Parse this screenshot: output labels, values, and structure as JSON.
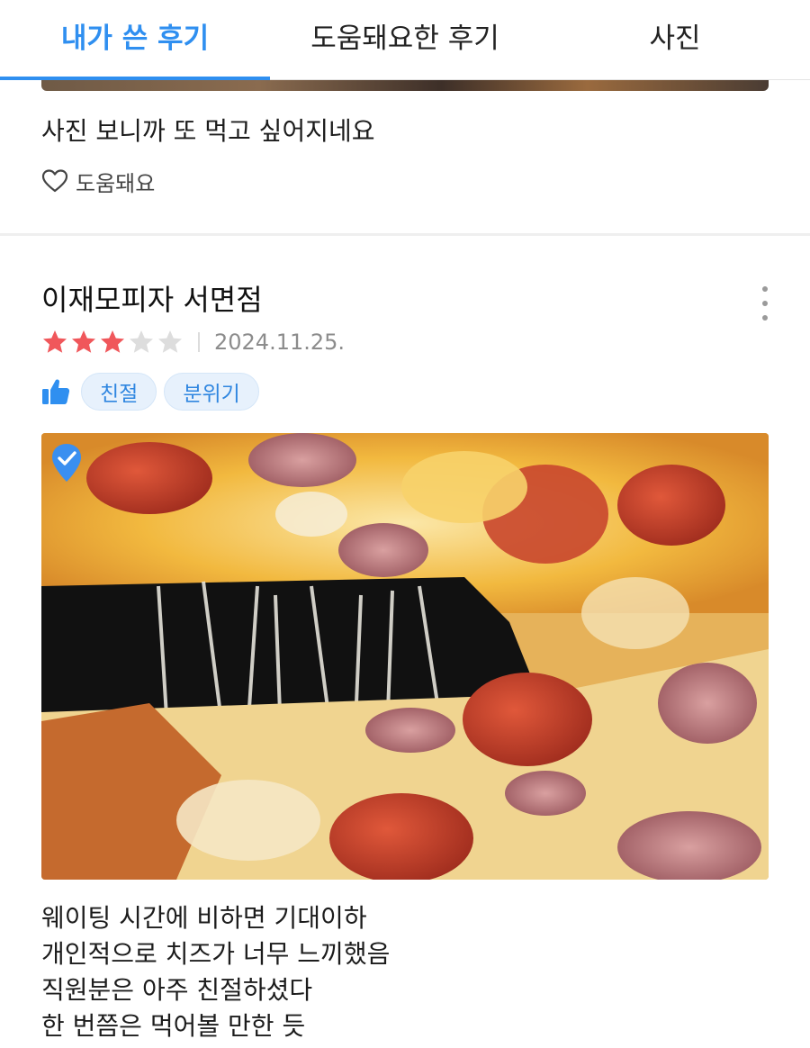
{
  "tabs": [
    {
      "label": "내가 쓴 후기",
      "active": true
    },
    {
      "label": "도움돼요한 후기",
      "active": false
    },
    {
      "label": "사진",
      "active": false
    }
  ],
  "previous_review": {
    "text": "사진 보니까 또 먹고 싶어지네요",
    "helpful_label": "도움돼요",
    "helpful_icon": "heart-outline-icon"
  },
  "review": {
    "store_name": "이재모피자 서면점",
    "rating": 3,
    "rating_max": 5,
    "date": "2024.11.25.",
    "like_icon": "thumbs-up-icon",
    "tags": [
      "친절",
      "분위기"
    ],
    "photo_badge_icon": "verified-check-icon",
    "body_lines": [
      "웨이팅 시간에 비하면 기대이하",
      "개인적으로 치즈가 너무 느끼했음",
      "직원분은 아주 친절하셨다",
      "한 번쯤은 먹어볼 만한 듯"
    ]
  },
  "colors": {
    "accent": "#2f8ff0",
    "star_filled": "#f0575b",
    "star_empty": "#dddddd",
    "chip_bg": "#e7f1fc"
  }
}
